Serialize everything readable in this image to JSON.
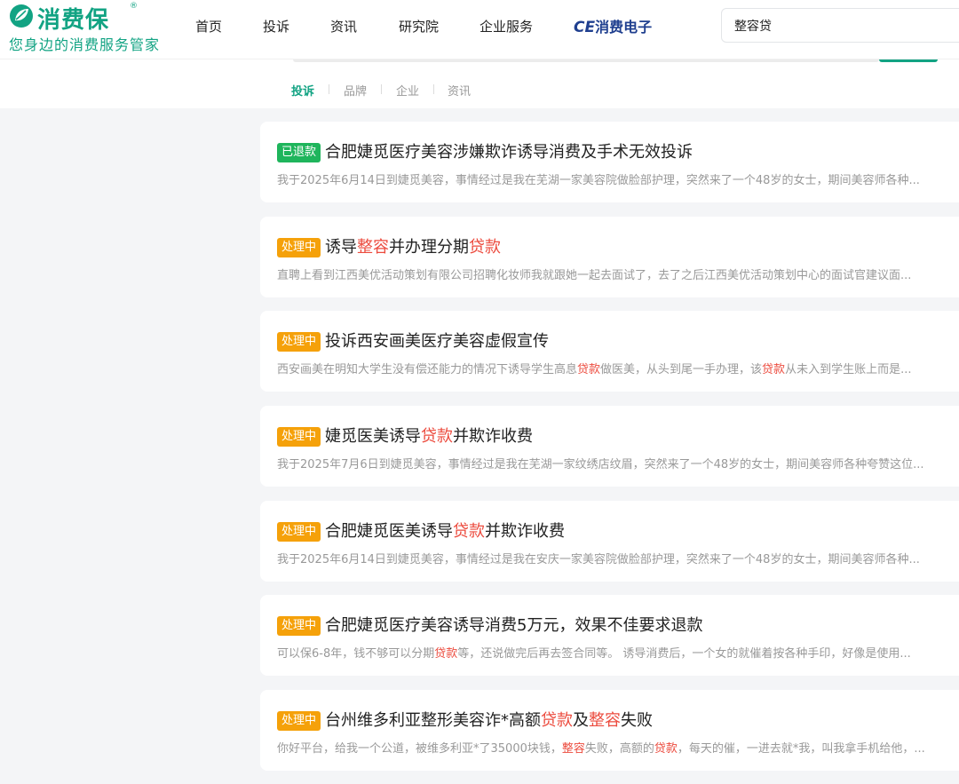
{
  "logo": {
    "text": "消费保",
    "reg": "®",
    "slogan": "您身边的消费服务管家"
  },
  "nav": [
    "首页",
    "投诉",
    "资讯",
    "研究院",
    "企业服务"
  ],
  "brand": {
    "ce": "CE",
    "cn": "消费电子"
  },
  "search": {
    "value": "整容贷"
  },
  "subtabs": [
    "投诉",
    "品牌",
    "企业",
    "资讯"
  ],
  "colors": {
    "brand_green": "#12a383",
    "refunded": "#1fb55c",
    "processing": "#f5a10a",
    "highlight": "#ec4b3e"
  },
  "complaints": [
    {
      "status": "已退款",
      "title": [
        {
          "t": "合肥婕觅医疗美容涉嫌欺诈诱导消费及手术无效投诉"
        }
      ],
      "desc": [
        {
          "t": "我于2025年6月14日到婕觅美容，事情经过是我在芜湖一家美容院做脸部护理，突然来了一个48岁的女士，期间美容师各种..."
        }
      ]
    },
    {
      "status": "处理中",
      "title": [
        {
          "t": "诱导"
        },
        {
          "t": "整容",
          "h": true
        },
        {
          "t": "并办理分期"
        },
        {
          "t": "贷款",
          "h": true
        }
      ],
      "desc": [
        {
          "t": "直聘上看到江西美优活动策划有限公司招聘化妆师我就跟她一起去面试了，去了之后江西美优活动策划中心的面试官建议面..."
        }
      ]
    },
    {
      "status": "处理中",
      "title": [
        {
          "t": "投诉西安画美医疗美容虚假宣传"
        }
      ],
      "desc": [
        {
          "t": "西安画美在明知大学生没有偿还能力的情况下诱导学生高息"
        },
        {
          "t": "贷款",
          "h": true
        },
        {
          "t": "做医美，从头到尾一手办理，该"
        },
        {
          "t": "贷款",
          "h": true
        },
        {
          "t": "从未入到学生账上而是..."
        }
      ]
    },
    {
      "status": "处理中",
      "title": [
        {
          "t": "婕觅医美诱导"
        },
        {
          "t": "贷款",
          "h": true
        },
        {
          "t": "并欺诈收费"
        }
      ],
      "desc": [
        {
          "t": "我于2025年7月6日到婕觅美容，事情经过是我在芜湖一家纹绣店纹眉，突然来了一个48岁的女士，期间美容师各种夸赞这位..."
        }
      ]
    },
    {
      "status": "处理中",
      "title": [
        {
          "t": "合肥婕觅医美诱导"
        },
        {
          "t": "贷款",
          "h": true
        },
        {
          "t": "并欺诈收费"
        }
      ],
      "desc": [
        {
          "t": "我于2025年6月14日到婕觅美容，事情经过是我在安庆一家美容院做脸部护理，突然来了一个48岁的女士，期间美容师各种..."
        }
      ]
    },
    {
      "status": "处理中",
      "title": [
        {
          "t": "合肥婕觅医疗美容诱导消费5万元，效果不佳要求退款"
        }
      ],
      "desc": [
        {
          "t": "可以保6-8年，钱不够可以分期"
        },
        {
          "t": "贷款",
          "h": true
        },
        {
          "t": "等，还说做完后再去签合同等。 诱导消费后，一个女的就催着按各种手印，好像是使用..."
        }
      ]
    },
    {
      "status": "处理中",
      "title": [
        {
          "t": "台州维多利亚整形美容诈*高额"
        },
        {
          "t": "贷款",
          "h": true
        },
        {
          "t": "及"
        },
        {
          "t": "整容",
          "h": true
        },
        {
          "t": "失败"
        }
      ],
      "desc": [
        {
          "t": "你好平台，给我一个公道，被维多利亚*了35000块钱，"
        },
        {
          "t": "整容",
          "h": true
        },
        {
          "t": "失败，高额的"
        },
        {
          "t": "贷款",
          "h": true
        },
        {
          "t": "，每天的催，一进去就*我，叫我拿手机给他，..."
        }
      ]
    }
  ]
}
